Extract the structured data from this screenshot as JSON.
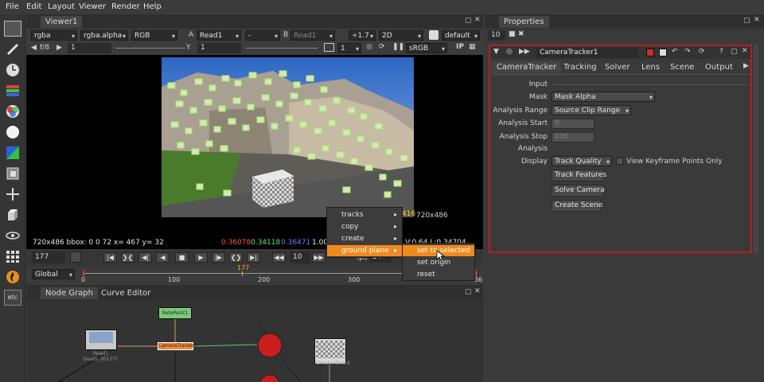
{
  "menubar": [
    "File",
    "Edit",
    "Layout",
    "Viewer",
    "Render",
    "Help"
  ],
  "viewer": {
    "tab": "Viewer1",
    "channels": "rgba",
    "alpha": "rgba.alpha",
    "colorspace": "RGB",
    "a_label": "A",
    "a_input": "Read1",
    "op": "-",
    "b_label": "B",
    "b_input": "Read1",
    "zoom": "÷1.7",
    "view_mode": "2D",
    "lut": "default",
    "fstop": "f/8",
    "gain": "1",
    "gamma_label": "Y",
    "gamma": "1",
    "proxy": "1",
    "display": "sRGB",
    "ip": "IP",
    "format_text": "720x486",
    "status_left": "720x486 bbox: 0 0 72  x= 467 y=  32",
    "status_r": "0.36078",
    "status_g": "0.34118",
    "status_b": "0.36471",
    "status_a": "1.00",
    "status_right": "V:0.64  L:0.34704",
    "frame": "416"
  },
  "context_menu": {
    "items": [
      "tracks",
      "copy",
      "create",
      "ground plane"
    ],
    "sub_items": [
      "set to selected",
      "set origin",
      "reset"
    ]
  },
  "timeline": {
    "frame": "177",
    "step": "10",
    "fps": "fps",
    "fps_value": "24",
    "range": "Global",
    "ticks": [
      "0",
      "100",
      "200",
      "300",
      "36"
    ],
    "marker": "177"
  },
  "nodegraph": {
    "tabs": [
      "Node Graph",
      "Curve Editor"
    ],
    "nodes": {
      "read": "Read1",
      "read_sub": "(beats_00177)",
      "roto": "RotoPaint1",
      "tracker": "CameraTracker1",
      "checker": "CheckerBoard"
    }
  },
  "properties": {
    "title": "Properties",
    "max_panels": "10",
    "node_name": "CameraTracker1",
    "tabs": [
      "CameraTracker",
      "Tracking",
      "Solver",
      "Lens",
      "Scene",
      "Output"
    ],
    "section_input": "Input",
    "mask_label": "Mask",
    "mask_value": "Mask Alpha",
    "range_label": "Analysis Range",
    "range_value": "Source Clip Range",
    "start_label": "Analysis Start",
    "start_value": "0",
    "stop_label": "Analysis Stop",
    "stop_value": "436",
    "section_analysis": "Analysis",
    "display_label": "Display",
    "display_value": "Track Quality",
    "keyframe_label": "View Keyframe Points Only",
    "buttons": [
      "Track Features",
      "Solve Camera",
      "Create Scene"
    ]
  },
  "toolbar_icons": [
    "image-icon",
    "paint-icon",
    "time-icon",
    "channel-icon",
    "color-icon",
    "filter-icon",
    "keyer-icon",
    "merge-icon",
    "transform-icon",
    "3d-icon",
    "views-icon",
    "metadata-icon",
    "furnace-icon",
    "other-icon"
  ],
  "toolbar_etc": "etc",
  "colors": {
    "accent": "#f08a1f",
    "selection_border": "#b32020",
    "status_red": "#ff5050",
    "status_green": "#55ee55",
    "status_blue": "#6a7cff"
  }
}
